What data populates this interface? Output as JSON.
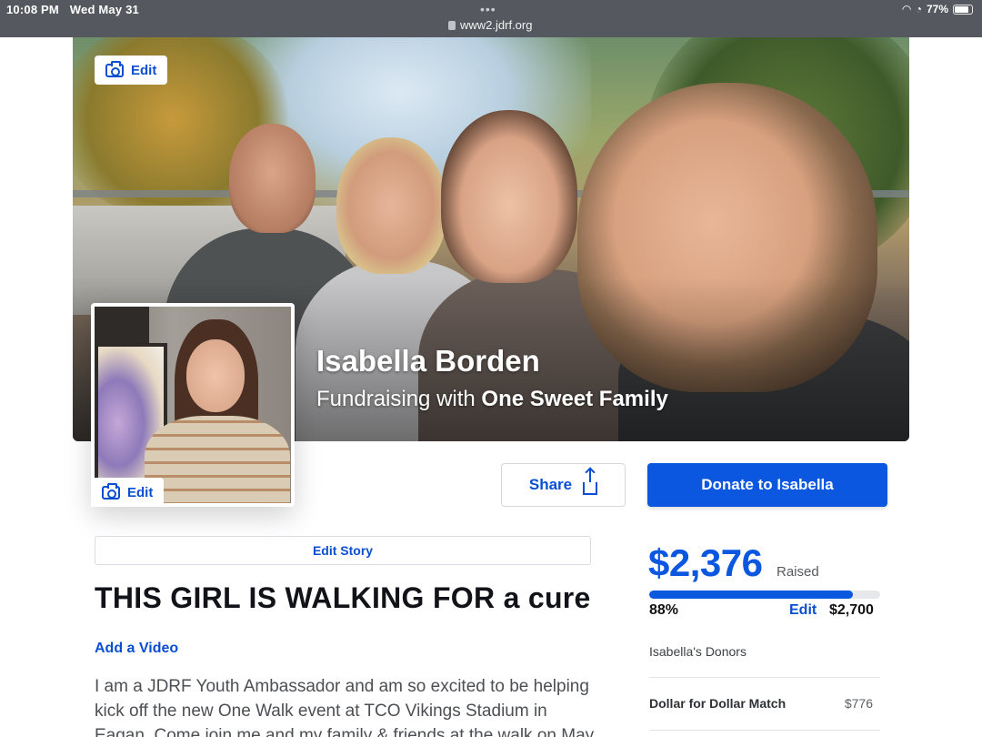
{
  "status_bar": {
    "time": "10:08 PM",
    "date": "Wed May 31",
    "url": "www2.jdrf.org",
    "battery": "77%"
  },
  "cover": {
    "edit_label": "Edit"
  },
  "profile": {
    "name": "Isabella Borden",
    "fundraising_prefix": "Fundraising with ",
    "team_name": "One Sweet Family",
    "photo_edit_label": "Edit"
  },
  "actions": {
    "share_label": "Share",
    "donate_label": "Donate to Isabella"
  },
  "story": {
    "edit_story_label": "Edit Story",
    "title": "THIS GIRL IS WALKING FOR a cure",
    "add_video_label": "Add a Video",
    "body": "I am a JDRF Youth Ambassador and am so excited to be helping kick off the new One Walk event at TCO Vikings Stadium in Eagan. Come join me and my family & friends at the walk on May"
  },
  "progress": {
    "raised_amount": "$2,376",
    "raised_label": "Raised",
    "percent_text": "88%",
    "percent_value": 0.88,
    "edit_label": "Edit",
    "goal": "$2,700",
    "donors_label": "Isabella's Donors",
    "donors": [
      {
        "name": "Dollar for Dollar Match",
        "amount": "$776"
      }
    ]
  },
  "colors": {
    "accent": "#0b57e0",
    "link": "#0b4fd1",
    "status_bar": "#55595f"
  }
}
